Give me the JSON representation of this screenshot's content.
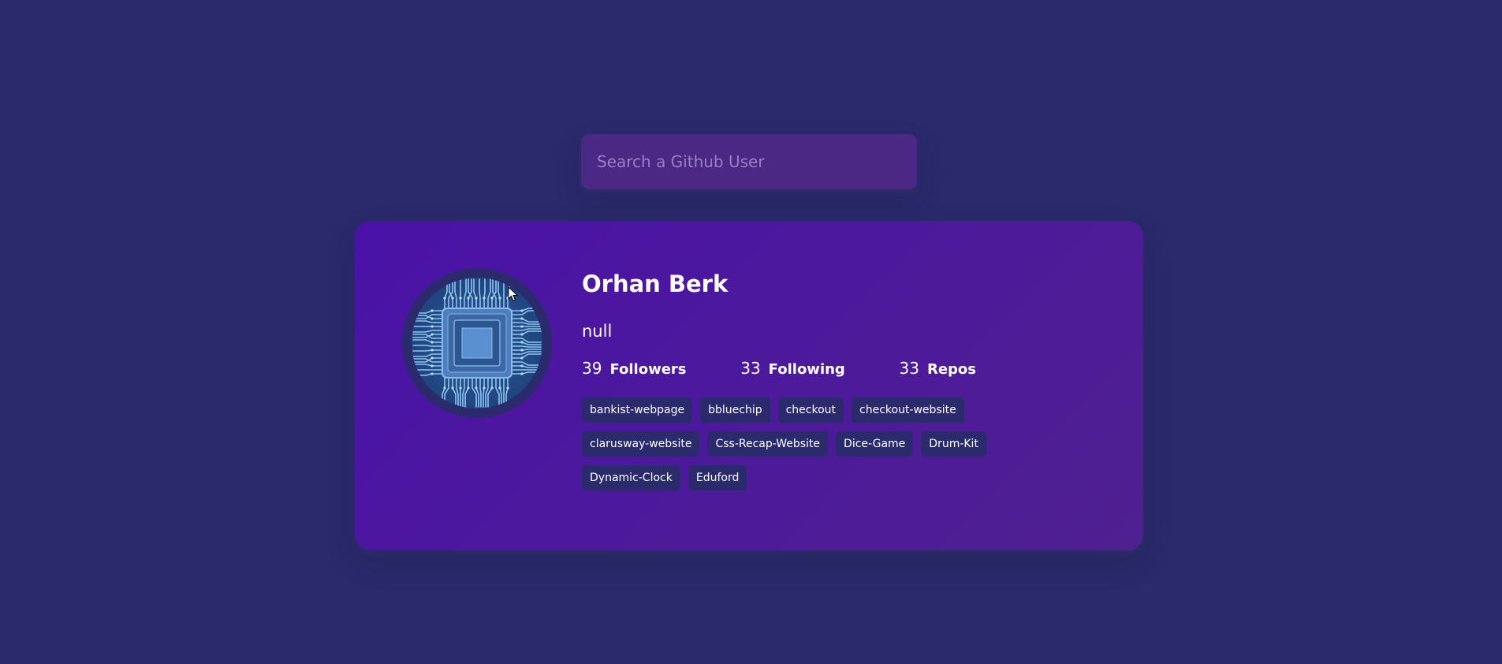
{
  "search": {
    "placeholder": "Search a Github User"
  },
  "profile": {
    "avatar_icon": "circuit-chip-avatar",
    "name": "Orhan Berk",
    "bio": "null",
    "stats": [
      {
        "count": "39",
        "label": "Followers"
      },
      {
        "count": "33",
        "label": "Following"
      },
      {
        "count": "33",
        "label": "Repos"
      }
    ],
    "repos": [
      "bankist-webpage",
      "bbluechip",
      "checkout",
      "checkout-website",
      "clarusway-website",
      "Css-Recap-Website",
      "Dice-Game",
      "Drum-Kit",
      "Dynamic-Clock",
      "Eduford"
    ]
  },
  "colors": {
    "background": "#2a2a6c",
    "search_bg": "#4c2885",
    "card_gradient_start": "#4a12a8",
    "card_gradient_end": "#4f2090",
    "repo_bg": "#2a2a6c"
  }
}
